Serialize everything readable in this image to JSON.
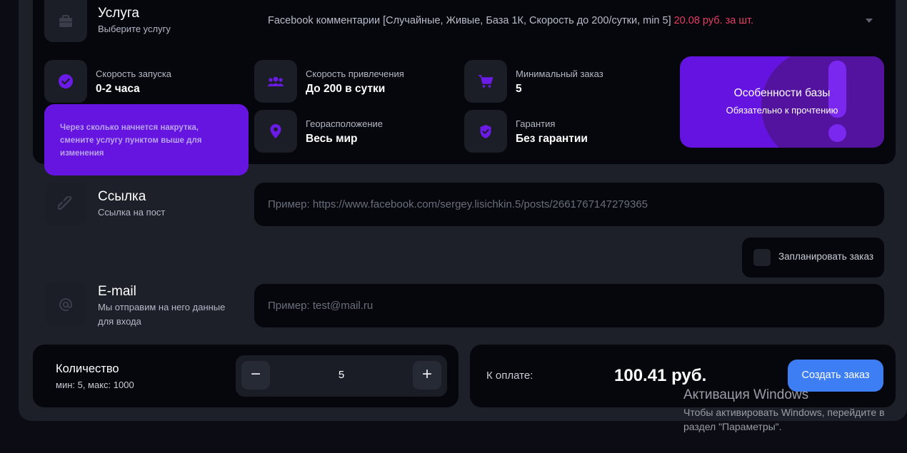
{
  "service": {
    "title": "Услуга",
    "subtitle": "Выберите услугу",
    "selected": "Facebook комментарии [Случайные, Живые, База 1К, Скорость до 200/сутки, min 5]",
    "price": "20.08 руб. за шт."
  },
  "stats": {
    "launch_label": "Скорость запуска",
    "launch_value": "0-2 часа",
    "speed_label": "Скорость привлечения",
    "speed_value": "До 200 в сутки",
    "geo_label": "Георасположение",
    "geo_value": "Весь мир",
    "min_label": "Минимальный заказ",
    "min_value": "5",
    "guarantee_label": "Гарантия",
    "guarantee_value": "Без гарантии"
  },
  "feature_card": {
    "title": "Особенности базы",
    "subtitle": "Обязательно к прочтению"
  },
  "tooltip": {
    "text": "Через сколько начнется накрутка, смените услугу пунктом выше для изменения"
  },
  "link": {
    "title": "Ссылка",
    "subtitle": "Ссылка на пост",
    "placeholder": "Пример: https://www.facebook.com/sergey.lisichkin.5/posts/2661767147279365"
  },
  "schedule": {
    "label": "Запланировать заказ"
  },
  "email": {
    "title": "E-mail",
    "subtitle": "Мы отправим на него данные для входа",
    "placeholder": "Пример: test@mail.ru"
  },
  "quantity": {
    "title": "Количество",
    "limits": "мин: 5, макс: 1000",
    "minus": "−",
    "plus": "+",
    "value": "5"
  },
  "payment": {
    "label": "К оплате:",
    "amount": "100.41 руб.",
    "button": "Создать заказ"
  },
  "windows": {
    "title": "Активация Windows",
    "line1": "Чтобы активировать Windows, перейдите в",
    "line2": "раздел \"Параметры\"."
  },
  "colors": {
    "accent_purple": "#6413e0",
    "price_red": "#e53e63",
    "button_blue": "#3d7ef5"
  },
  "icons": [
    "briefcase-icon",
    "check-circle-icon",
    "users-icon",
    "cart-icon",
    "location-pin-icon",
    "shield-check-icon",
    "link-icon",
    "at-icon"
  ]
}
